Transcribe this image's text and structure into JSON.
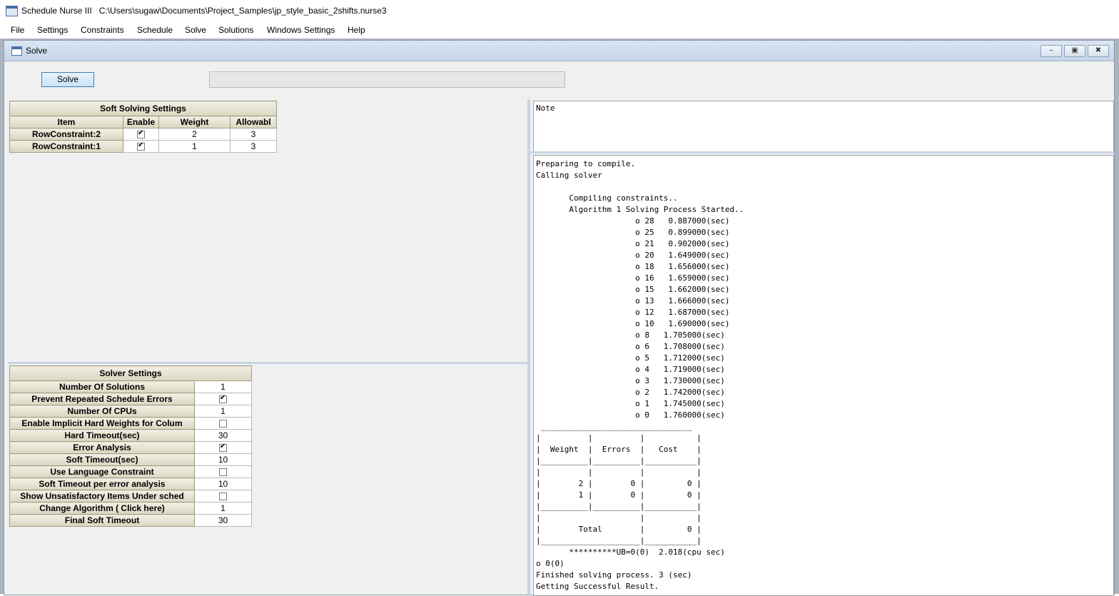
{
  "app": {
    "title": "Schedule Nurse III   C:\\Users\\sugaw\\Documents\\Project_Samples\\jp_style_basic_2shifts.nurse3",
    "icon": "app-window-icon"
  },
  "menu": [
    "File",
    "Settings",
    "Constraints",
    "Schedule",
    "Solve",
    "Solutions",
    "Windows Settings",
    "Help"
  ],
  "child_window": {
    "title": "Solve",
    "minimize_glyph": "–",
    "restore_glyph": "▣",
    "close_glyph": "✖"
  },
  "solve_button": "Solve",
  "progress": {
    "fraction": 0.0,
    "color": "#06b025"
  },
  "soft_settings": {
    "title": "Soft Solving Settings",
    "headers": [
      "Item",
      "Enable",
      "Weight",
      "Allowabl"
    ],
    "rows": [
      {
        "item": "RowConstraint:2",
        "enable": true,
        "weight": "2",
        "allowable": "3"
      },
      {
        "item": "RowConstraint:1",
        "enable": true,
        "weight": "1",
        "allowable": "3"
      }
    ]
  },
  "solver_settings": {
    "title": "Solver Settings",
    "rows": [
      {
        "label": "Number Of Solutions",
        "value": "1"
      },
      {
        "label": "Prevent Repeated Schedule Errors",
        "check": true
      },
      {
        "label": "Number Of CPUs",
        "value": "1"
      },
      {
        "label": "Enable Implicit Hard Weights for Colum",
        "check": false
      },
      {
        "label": "Hard Timeout(sec)",
        "value": "30"
      },
      {
        "label": "Error Analysis",
        "check": true
      },
      {
        "label": "Soft Timeout(sec)",
        "value": "10"
      },
      {
        "label": "Use Language Constraint",
        "check": false
      },
      {
        "label": "Soft Timeout per error analysis",
        "value": "10"
      },
      {
        "label": "Show Unsatisfactory Items Under sched",
        "check": false
      },
      {
        "label": "Change Algorithm ( Click here)",
        "value": "1"
      },
      {
        "label": "Final Soft Timeout",
        "value": "30"
      }
    ]
  },
  "note": {
    "label": "Note"
  },
  "log_lines": [
    "Preparing to compile.",
    "Calling solver",
    "",
    "       Compiling constraints..",
    "       Algorithm 1 Solving Process Started..",
    "                     o 28   0.887000(sec)",
    "                     o 25   0.899000(sec)",
    "                     o 21   0.902000(sec)",
    "                     o 20   1.649000(sec)",
    "                     o 18   1.656000(sec)",
    "                     o 16   1.659000(sec)",
    "                     o 15   1.662000(sec)",
    "                     o 13   1.666000(sec)",
    "                     o 12   1.687000(sec)",
    "                     o 10   1.690000(sec)",
    "                     o 8   1.705000(sec)",
    "                     o 6   1.708000(sec)",
    "                     o 5   1.712000(sec)",
    "                     o 4   1.719000(sec)",
    "                     o 3   1.730000(sec)",
    "                     o 2   1.742000(sec)",
    "                     o 1   1.745000(sec)",
    "                     o 0   1.760000(sec)",
    " ________________________________",
    "|          |          |           |",
    "|  Weight  |  Errors  |   Cost    |",
    "|__________|__________|___________|",
    "|          |          |           |",
    "|        2 |        0 |         0 |",
    "|        1 |        0 |         0 |",
    "|__________|__________|___________|",
    "|                     |           |",
    "|        Total        |         0 |",
    "|_____________________|___________|",
    "       **********UB=0(0)  2.018(cpu sec)",
    "o 0(0)",
    "Finished solving process. 3 (sec)",
    "Getting Successful Result."
  ]
}
